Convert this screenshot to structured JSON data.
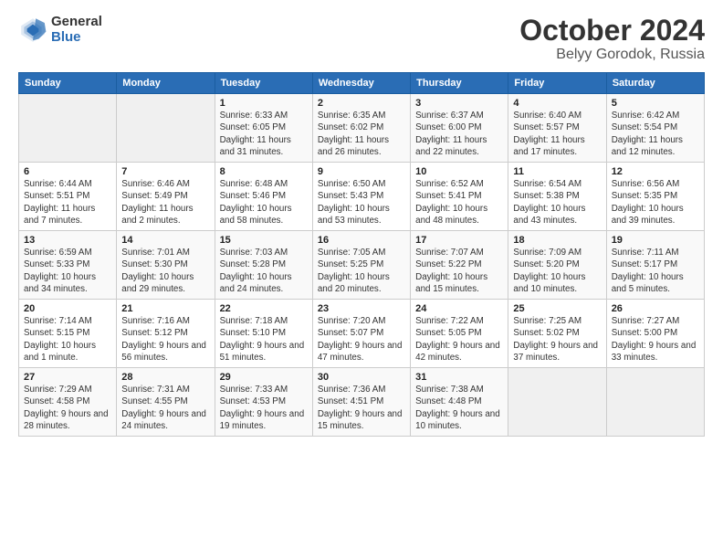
{
  "header": {
    "logo_general": "General",
    "logo_blue": "Blue",
    "month_title": "October 2024",
    "location": "Belyy Gorodok, Russia"
  },
  "days_of_week": [
    "Sunday",
    "Monday",
    "Tuesday",
    "Wednesday",
    "Thursday",
    "Friday",
    "Saturday"
  ],
  "weeks": [
    [
      {
        "day": "",
        "info": ""
      },
      {
        "day": "",
        "info": ""
      },
      {
        "day": "1",
        "info": "Sunrise: 6:33 AM\nSunset: 6:05 PM\nDaylight: 11 hours and 31 minutes."
      },
      {
        "day": "2",
        "info": "Sunrise: 6:35 AM\nSunset: 6:02 PM\nDaylight: 11 hours and 26 minutes."
      },
      {
        "day": "3",
        "info": "Sunrise: 6:37 AM\nSunset: 6:00 PM\nDaylight: 11 hours and 22 minutes."
      },
      {
        "day": "4",
        "info": "Sunrise: 6:40 AM\nSunset: 5:57 PM\nDaylight: 11 hours and 17 minutes."
      },
      {
        "day": "5",
        "info": "Sunrise: 6:42 AM\nSunset: 5:54 PM\nDaylight: 11 hours and 12 minutes."
      }
    ],
    [
      {
        "day": "6",
        "info": "Sunrise: 6:44 AM\nSunset: 5:51 PM\nDaylight: 11 hours and 7 minutes."
      },
      {
        "day": "7",
        "info": "Sunrise: 6:46 AM\nSunset: 5:49 PM\nDaylight: 11 hours and 2 minutes."
      },
      {
        "day": "8",
        "info": "Sunrise: 6:48 AM\nSunset: 5:46 PM\nDaylight: 10 hours and 58 minutes."
      },
      {
        "day": "9",
        "info": "Sunrise: 6:50 AM\nSunset: 5:43 PM\nDaylight: 10 hours and 53 minutes."
      },
      {
        "day": "10",
        "info": "Sunrise: 6:52 AM\nSunset: 5:41 PM\nDaylight: 10 hours and 48 minutes."
      },
      {
        "day": "11",
        "info": "Sunrise: 6:54 AM\nSunset: 5:38 PM\nDaylight: 10 hours and 43 minutes."
      },
      {
        "day": "12",
        "info": "Sunrise: 6:56 AM\nSunset: 5:35 PM\nDaylight: 10 hours and 39 minutes."
      }
    ],
    [
      {
        "day": "13",
        "info": "Sunrise: 6:59 AM\nSunset: 5:33 PM\nDaylight: 10 hours and 34 minutes."
      },
      {
        "day": "14",
        "info": "Sunrise: 7:01 AM\nSunset: 5:30 PM\nDaylight: 10 hours and 29 minutes."
      },
      {
        "day": "15",
        "info": "Sunrise: 7:03 AM\nSunset: 5:28 PM\nDaylight: 10 hours and 24 minutes."
      },
      {
        "day": "16",
        "info": "Sunrise: 7:05 AM\nSunset: 5:25 PM\nDaylight: 10 hours and 20 minutes."
      },
      {
        "day": "17",
        "info": "Sunrise: 7:07 AM\nSunset: 5:22 PM\nDaylight: 10 hours and 15 minutes."
      },
      {
        "day": "18",
        "info": "Sunrise: 7:09 AM\nSunset: 5:20 PM\nDaylight: 10 hours and 10 minutes."
      },
      {
        "day": "19",
        "info": "Sunrise: 7:11 AM\nSunset: 5:17 PM\nDaylight: 10 hours and 5 minutes."
      }
    ],
    [
      {
        "day": "20",
        "info": "Sunrise: 7:14 AM\nSunset: 5:15 PM\nDaylight: 10 hours and 1 minute."
      },
      {
        "day": "21",
        "info": "Sunrise: 7:16 AM\nSunset: 5:12 PM\nDaylight: 9 hours and 56 minutes."
      },
      {
        "day": "22",
        "info": "Sunrise: 7:18 AM\nSunset: 5:10 PM\nDaylight: 9 hours and 51 minutes."
      },
      {
        "day": "23",
        "info": "Sunrise: 7:20 AM\nSunset: 5:07 PM\nDaylight: 9 hours and 47 minutes."
      },
      {
        "day": "24",
        "info": "Sunrise: 7:22 AM\nSunset: 5:05 PM\nDaylight: 9 hours and 42 minutes."
      },
      {
        "day": "25",
        "info": "Sunrise: 7:25 AM\nSunset: 5:02 PM\nDaylight: 9 hours and 37 minutes."
      },
      {
        "day": "26",
        "info": "Sunrise: 7:27 AM\nSunset: 5:00 PM\nDaylight: 9 hours and 33 minutes."
      }
    ],
    [
      {
        "day": "27",
        "info": "Sunrise: 7:29 AM\nSunset: 4:58 PM\nDaylight: 9 hours and 28 minutes."
      },
      {
        "day": "28",
        "info": "Sunrise: 7:31 AM\nSunset: 4:55 PM\nDaylight: 9 hours and 24 minutes."
      },
      {
        "day": "29",
        "info": "Sunrise: 7:33 AM\nSunset: 4:53 PM\nDaylight: 9 hours and 19 minutes."
      },
      {
        "day": "30",
        "info": "Sunrise: 7:36 AM\nSunset: 4:51 PM\nDaylight: 9 hours and 15 minutes."
      },
      {
        "day": "31",
        "info": "Sunrise: 7:38 AM\nSunset: 4:48 PM\nDaylight: 9 hours and 10 minutes."
      },
      {
        "day": "",
        "info": ""
      },
      {
        "day": "",
        "info": ""
      }
    ]
  ]
}
